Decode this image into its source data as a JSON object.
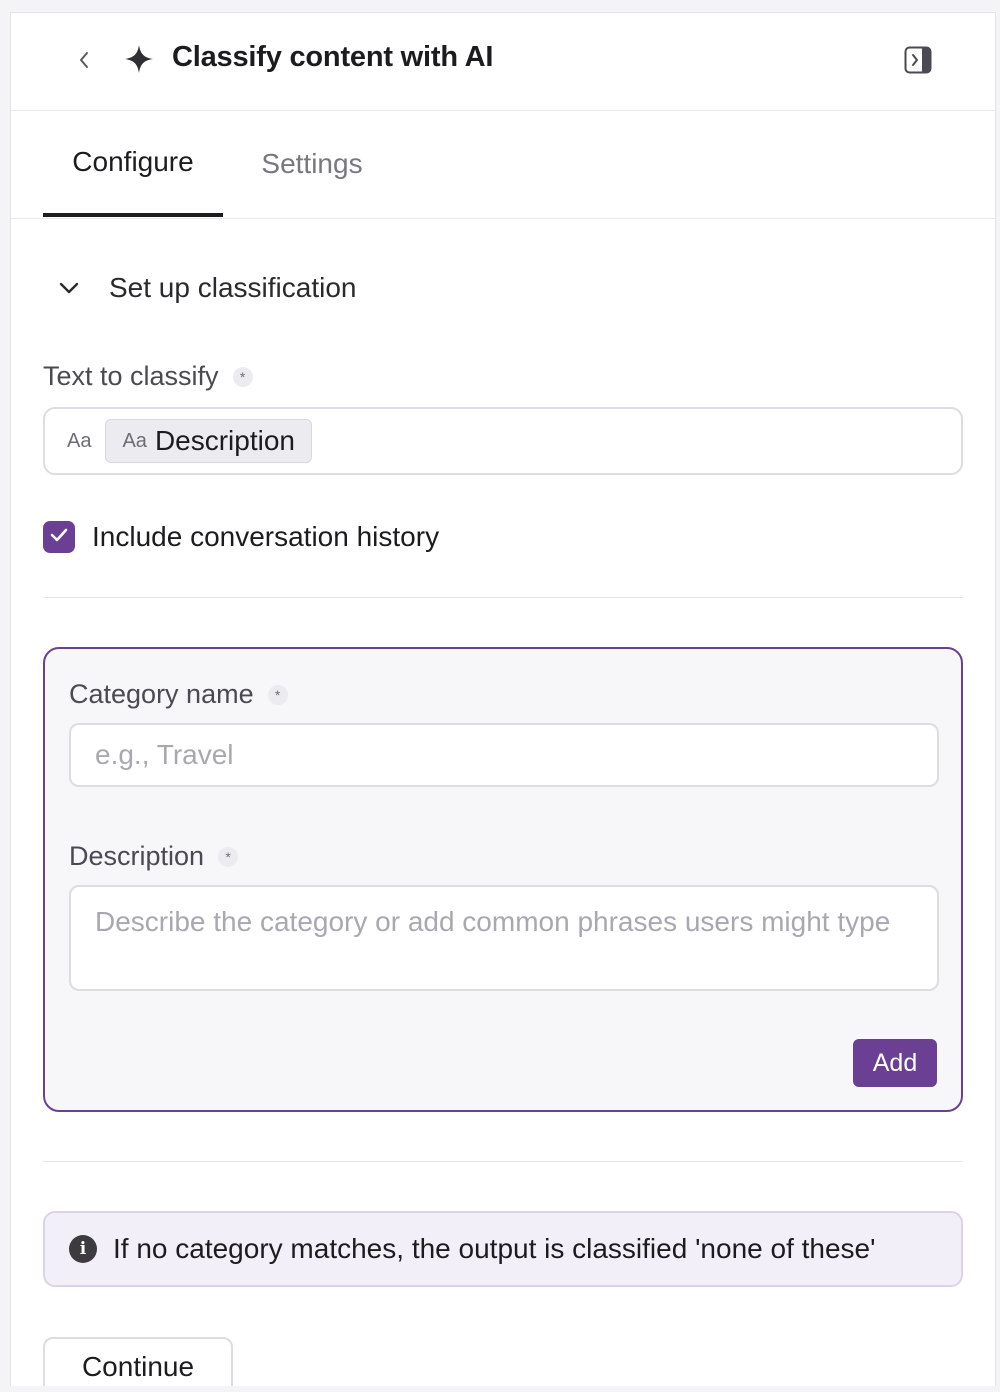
{
  "header": {
    "title": "Classify content with AI",
    "back_icon": "chevron-left-icon",
    "title_icon": "sparkle-icon",
    "panel_icon": "sidebar-toggle-icon"
  },
  "tabs": [
    {
      "label": "Configure",
      "active": true
    },
    {
      "label": "Settings",
      "active": false
    }
  ],
  "section": {
    "title": "Set up classification",
    "expanded": true
  },
  "text_to_classify": {
    "label": "Text to classify",
    "required_mark": "*",
    "prefix": "Aa",
    "chip_prefix": "Aa",
    "chip_label": "Description"
  },
  "conversation_history": {
    "label": "Include conversation history",
    "checked": true
  },
  "category_form": {
    "name_label": "Category name",
    "name_placeholder": "e.g., Travel",
    "description_label": "Description",
    "description_placeholder": "Describe the category or add common phrases users might type",
    "required_mark": "*",
    "add_label": "Add"
  },
  "info": {
    "icon": "i",
    "text": "If no category matches, the output is classified 'none of these'"
  },
  "footer": {
    "continue_label": "Continue"
  },
  "colors": {
    "accent": "#6a3f94",
    "info_bg": "#f3eff9",
    "card_bg": "#f7f7fa"
  }
}
